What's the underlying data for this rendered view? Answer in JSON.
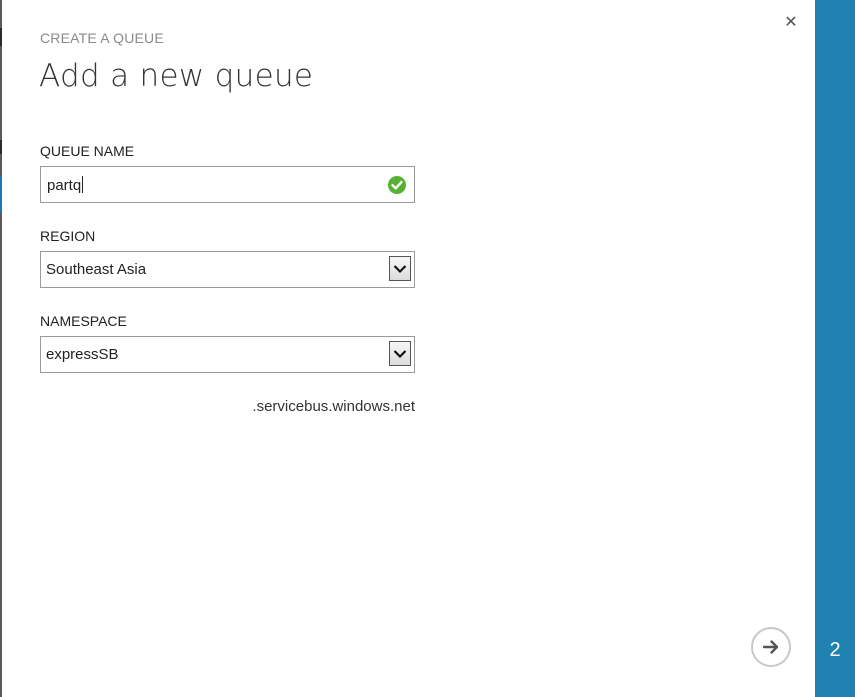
{
  "dialog": {
    "subtitle": "CREATE A QUEUE",
    "title": "Add a new queue",
    "close_icon": "close-icon"
  },
  "form": {
    "queue_name": {
      "label": "QUEUE NAME",
      "value": "partq",
      "status_icon": "check-icon",
      "status_color": "#57b134"
    },
    "region": {
      "label": "REGION",
      "value": "Southeast Asia"
    },
    "namespace": {
      "label": "NAMESPACE",
      "value": "expressSB",
      "suffix": ".servicebus.windows.net"
    }
  },
  "footer": {
    "next_icon": "arrow-right-icon"
  },
  "wizard": {
    "step": "2",
    "accent_color": "#1f82b0"
  }
}
